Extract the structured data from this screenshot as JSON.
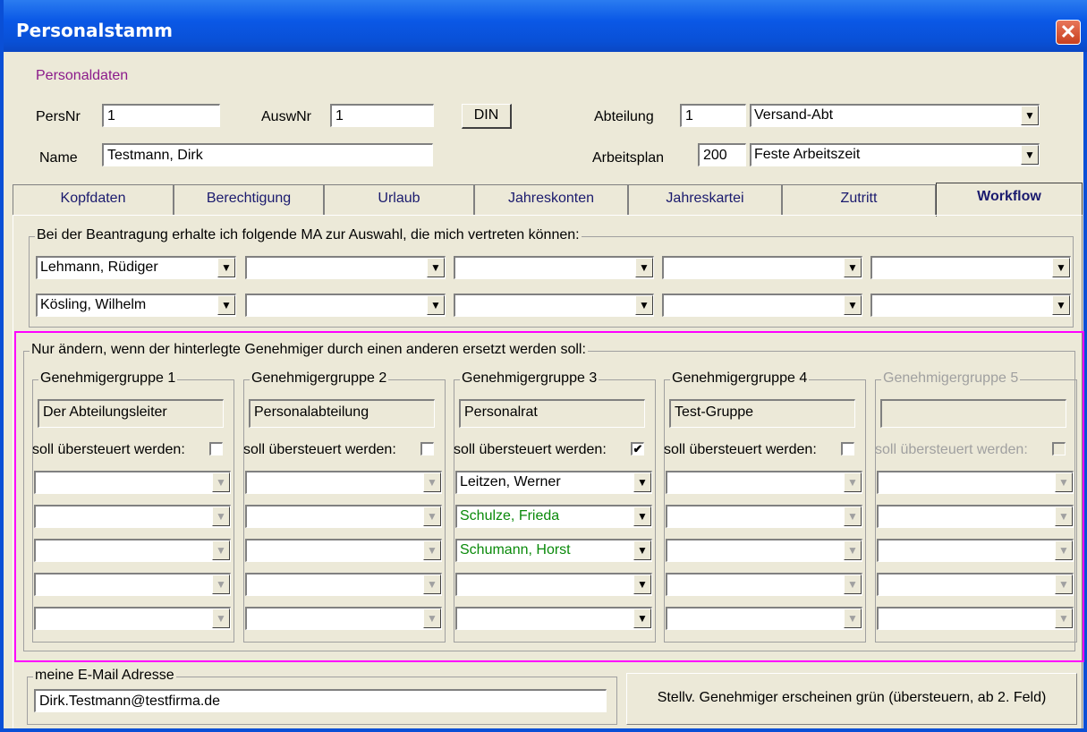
{
  "window": {
    "title": "Personalstamm",
    "close_glyph": "✕"
  },
  "personal": {
    "section_label": "Personaldaten",
    "persnr_label": "PersNr",
    "persnr_value": "1",
    "auswnr_label": "AuswNr",
    "auswnr_value": "1",
    "din_button": "DIN",
    "abteilung_label": "Abteilung",
    "abteilung_code": "1",
    "abteilung_name": "Versand-Abt",
    "name_label": "Name",
    "name_value": "Testmann, Dirk",
    "arbeitsplan_label": "Arbeitsplan",
    "arbeitsplan_code": "200",
    "arbeitsplan_name": "Feste Arbeitszeit"
  },
  "tabs": [
    {
      "label": "Kopfdaten"
    },
    {
      "label": "Berechtigung"
    },
    {
      "label": "Urlaub"
    },
    {
      "label": "Jahreskonten"
    },
    {
      "label": "Jahreskartei"
    },
    {
      "label": "Zutritt"
    },
    {
      "label": "Workflow"
    }
  ],
  "active_tab": "Workflow",
  "vertreter": {
    "group_label": "Bei der Beantragung erhalte ich folgende MA zur Auswahl, die mich vertreten können:",
    "row1": [
      "Lehmann, Rüdiger",
      "",
      "",
      "",
      ""
    ],
    "row2": [
      "Kösling, Wilhelm",
      "",
      "",
      "",
      ""
    ]
  },
  "genehmiger": {
    "group_label": "Nur ändern, wenn der hinterlegte Genehmiger durch einen anderen ersetzt werden soll:",
    "override_label": "soll übersteuert werden:",
    "groups": [
      {
        "title": "Genehmigergruppe 1",
        "name": "Der Abteilungsleiter",
        "checked": "",
        "entries": [
          "",
          "",
          "",
          "",
          ""
        ]
      },
      {
        "title": "Genehmigergruppe 2",
        "name": "Personalabteilung",
        "checked": "",
        "entries": [
          "",
          "",
          "",
          "",
          ""
        ]
      },
      {
        "title": "Genehmigergruppe 3",
        "name": "Personalrat",
        "checked": "✔",
        "entries": [
          "Leitzen, Werner",
          "Schulze, Frieda",
          "Schumann, Horst",
          "",
          ""
        ]
      },
      {
        "title": "Genehmigergruppe 4",
        "name": "Test-Gruppe",
        "checked": "",
        "entries": [
          "",
          "",
          "",
          "",
          ""
        ]
      },
      {
        "title": "Genehmigergruppe 5",
        "name": "",
        "checked": "",
        "entries": [
          "",
          "",
          "",
          "",
          ""
        ]
      }
    ],
    "highlight_color": "#ff00ff",
    "substitute_color": "#0a8a0a"
  },
  "email": {
    "group_label": "meine E-Mail Adresse",
    "value": "Dirk.Testmann@testfirma.de"
  },
  "hint": "Stellv. Genehmiger erscheinen grün (übersteuern, ab 2. Feld)",
  "icons": {
    "dropdown": "▼",
    "close": "close-icon"
  }
}
